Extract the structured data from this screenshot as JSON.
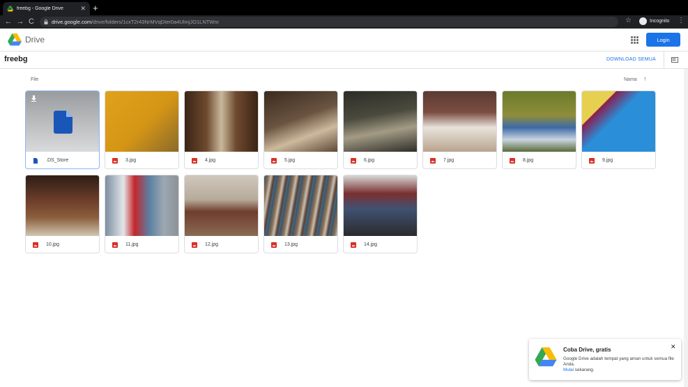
{
  "browser": {
    "tab_title": "freebg - Google Drive",
    "tab_close": "✕",
    "new_tab": "+",
    "url_host": "drive.google.com",
    "url_path": "/drive/folders/1cxT2r43NrMVqDIer0a4UlmjJO1LNTWnr",
    "back": "←",
    "forward": "→",
    "reload": "C",
    "star": "☆",
    "incognito_label": "Incognito",
    "menu": "⋮"
  },
  "header": {
    "brand": "Drive",
    "login_label": "Login"
  },
  "subbar": {
    "folder_name": "freebg",
    "download_label": "DOWNLOAD SEMUA"
  },
  "list": {
    "section_label": "File",
    "sort_label": "Nama",
    "sort_arrow": "↑"
  },
  "files": [
    {
      "name": ".DS_Store",
      "kind": "document",
      "selected": true,
      "bg": "linear-gradient(#999c9f, #d9dadb)"
    },
    {
      "name": "3.jpg",
      "kind": "image",
      "bg": "linear-gradient(135deg, #e0a21c 0%, #d49516 55%, #8a6a2a 100%)"
    },
    {
      "name": "4.jpg",
      "kind": "image",
      "bg": "linear-gradient(90deg, #3b2415 0%, #6e4a2f 30%, #c9b89c 50%, #6e4a2f 70%, #3b2415 100%)"
    },
    {
      "name": "5.jpg",
      "kind": "image",
      "bg": "linear-gradient(160deg, #3a2a1e 0%, #6a5441 45%, #cdb99d 70%, #5d4836 100%)"
    },
    {
      "name": "6.jpg",
      "kind": "image",
      "bg": "linear-gradient(170deg, #2c2c26 0%, #4a4a3e 40%, #a39b85 65%, #2e2d28 100%)"
    },
    {
      "name": "7.jpg",
      "kind": "image",
      "bg": "linear-gradient(180deg, #5a3b32 0%, #7c4d41 35%, #e8e3dc 60%, #b9a48e 100%)"
    },
    {
      "name": "8.jpg",
      "kind": "image",
      "bg": "linear-gradient(180deg, #6a7b2c 0%, #8f8d39 40%, #3d6aa8 60%, #c9d4df 80%, #5a6c3a 100%)"
    },
    {
      "name": "9.jpg",
      "kind": "image",
      "bg": "linear-gradient(135deg, #e7d050 0%, #e7d050 25%, #8b1e4f 26%, #2a8ed8 45%, #2a8ed8 100%)"
    },
    {
      "name": "10.jpg",
      "kind": "image",
      "bg": "linear-gradient(180deg, #2d1d14 0%, #6b3c2a 40%, #8c5f3e 70%, #d1c6b0 100%)"
    },
    {
      "name": "11.jpg",
      "kind": "image",
      "bg": "linear-gradient(90deg, #7d8ea0 0%, #e2e6e9 25%, #c6262b 40%, #5a7fa2 60%, #9ca8b1 80%, #8c9298 100%)"
    },
    {
      "name": "12.jpg",
      "kind": "image",
      "bg": "linear-gradient(180deg, #d0c7bc 0%, #b7aa9b 40%, #6f3d2c 60%, #8a6a52 100%)"
    },
    {
      "name": "13.jpg",
      "kind": "image",
      "bg": "repeating-linear-gradient(100deg, #32526e 0px, #8c6f52 6px, #c6c0b4 10px, #5b3f33 14px, #3f6f8c 18px)"
    },
    {
      "name": "14.jpg",
      "kind": "image",
      "bg": "linear-gradient(180deg, #d6d8d6 0%, #7a2f30 30%, #405272 55%, #2b2a2c 100%)"
    }
  ],
  "toast": {
    "title": "Coba Drive, gratis",
    "body": "Google Drive adalah tempat yang aman untuk semua file Anda.",
    "link_label": "Mulai",
    "link_suffix": " sekarang.",
    "close": "✕"
  },
  "colors": {
    "accent": "#1a73e8",
    "image_icon": "#d93025",
    "doc_icon": "#1a56b8"
  }
}
